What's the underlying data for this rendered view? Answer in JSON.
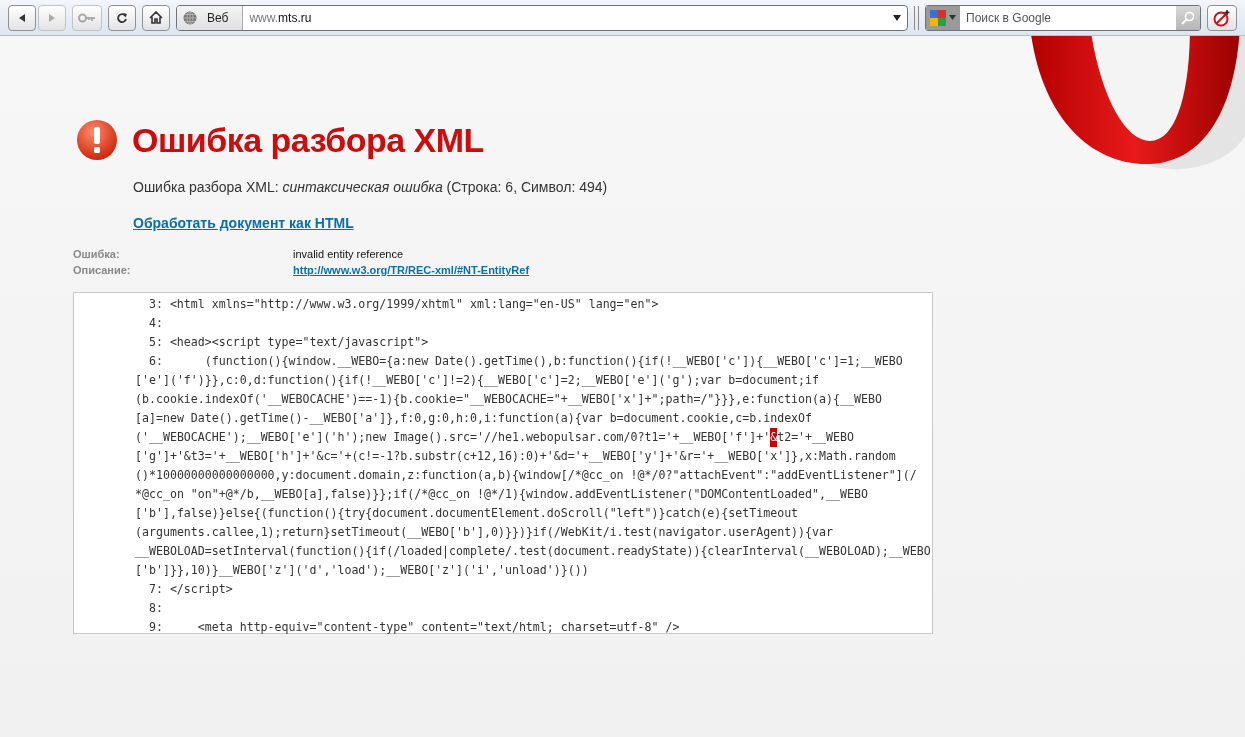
{
  "toolbar": {
    "back_disabled": false,
    "forward_disabled": true,
    "wand_disabled": true,
    "address_prefix": "Веб",
    "address_host_prefix": "www.",
    "address_host": "mts.ru",
    "search_placeholder": "Поиск в Google"
  },
  "error": {
    "title": "Ошибка разбора XML",
    "message": "Ошибка разбора XML: *синтаксическая ошибка* (Строка: 6, Символ: 494)",
    "reparse_link": "Обработать документ как HTML",
    "details": [
      {
        "label": "Ошибка:",
        "value": "invalid entity reference",
        "kind": "text"
      },
      {
        "label": "Описание:",
        "value": "http://www.w3.org/TR/REC-xml/#NT-EntityRef",
        "kind": "link"
      }
    ]
  },
  "code": [
    {
      "number": "3:",
      "text": "<html xmlns=\"http://www.w3.org/1999/xhtml\" xml:lang=\"en-US\" lang=\"en\">"
    },
    {
      "number": "4:"
    },
    {
      "number": "5:",
      "text": "<head><script type=\"text/javascript\">"
    },
    {
      "number": "6:",
      "text": "     (function(){window.__WEBO={a:new Date().getTime(),b:function(){if(!__WEBO['c']){__WEBO['c']=1;__WEBO"
    },
    {
      "text": "['e']('f')}},c:0,d:function(){if(!__WEBO['c']!=2){__WEBO['c']=2;__WEBO['e']('g');var b=document;if"
    },
    {
      "text": "(b.cookie.indexOf('__WEBOCACHE')==-1){b.cookie=\"__WEBOCACHE=\"+__WEBO['x']+\";path=/\"}}},e:function(a){__WEBO"
    },
    {
      "text": "[a]=new Date().getTime()-__WEBO['a']},f:0,g:0,h:0,i:function(a){var b=document.cookie,c=b.indexOf"
    },
    {
      "text": "('__WEBOCACHE');__WEBO['e']('h');new Image().src='//he1.webopulsar.com/0?t1='+__WEBO['f']+'",
      "error": "&",
      "after": "t2='+__WEBO"
    },
    {
      "text": "['g']+'&t3='+__WEBO['h']+'&c='+(c!=-1?b.substr(c+12,16):0)+'&d='+__WEBO['y']+'&r='+__WEBO['x']},x:Math.random"
    },
    {
      "text": "()*10000000000000000,y:document.domain,z:function(a,b){window[/*@cc_on !@*/0?\"attachEvent\":\"addEventListener\"](/"
    },
    {
      "text": "*@cc_on \"on\"+@*/b,__WEBO[a],false)}};if(/*@cc_on !@*/1){window.addEventListener(\"DOMContentLoaded\",__WEBO"
    },
    {
      "text": "['b'],false)}else{(function(){try{document.documentElement.doScroll(\"left\")}catch(e){setTimeout"
    },
    {
      "text": "(arguments.callee,1);return}setTimeout(__WEBO['b'],0)}})}if(/WebKit/i.test(navigator.userAgent)){var"
    },
    {
      "text": "__WEBOLOAD=setInterval(function(){if(/loaded|complete/.test(document.readyState)){clearInterval(__WEBOLOAD);__WEBO"
    },
    {
      "text": "['b']}},10)}__WEBO['z']('d','load');__WEBO['z']('i','unload')}())"
    },
    {
      "number": "7:",
      "text": "</script>"
    },
    {
      "number": "8:"
    },
    {
      "number": "9:",
      "text": "    <meta http-equiv=\"content-type\" content=\"text/html; charset=utf-8\" />"
    }
  ]
}
